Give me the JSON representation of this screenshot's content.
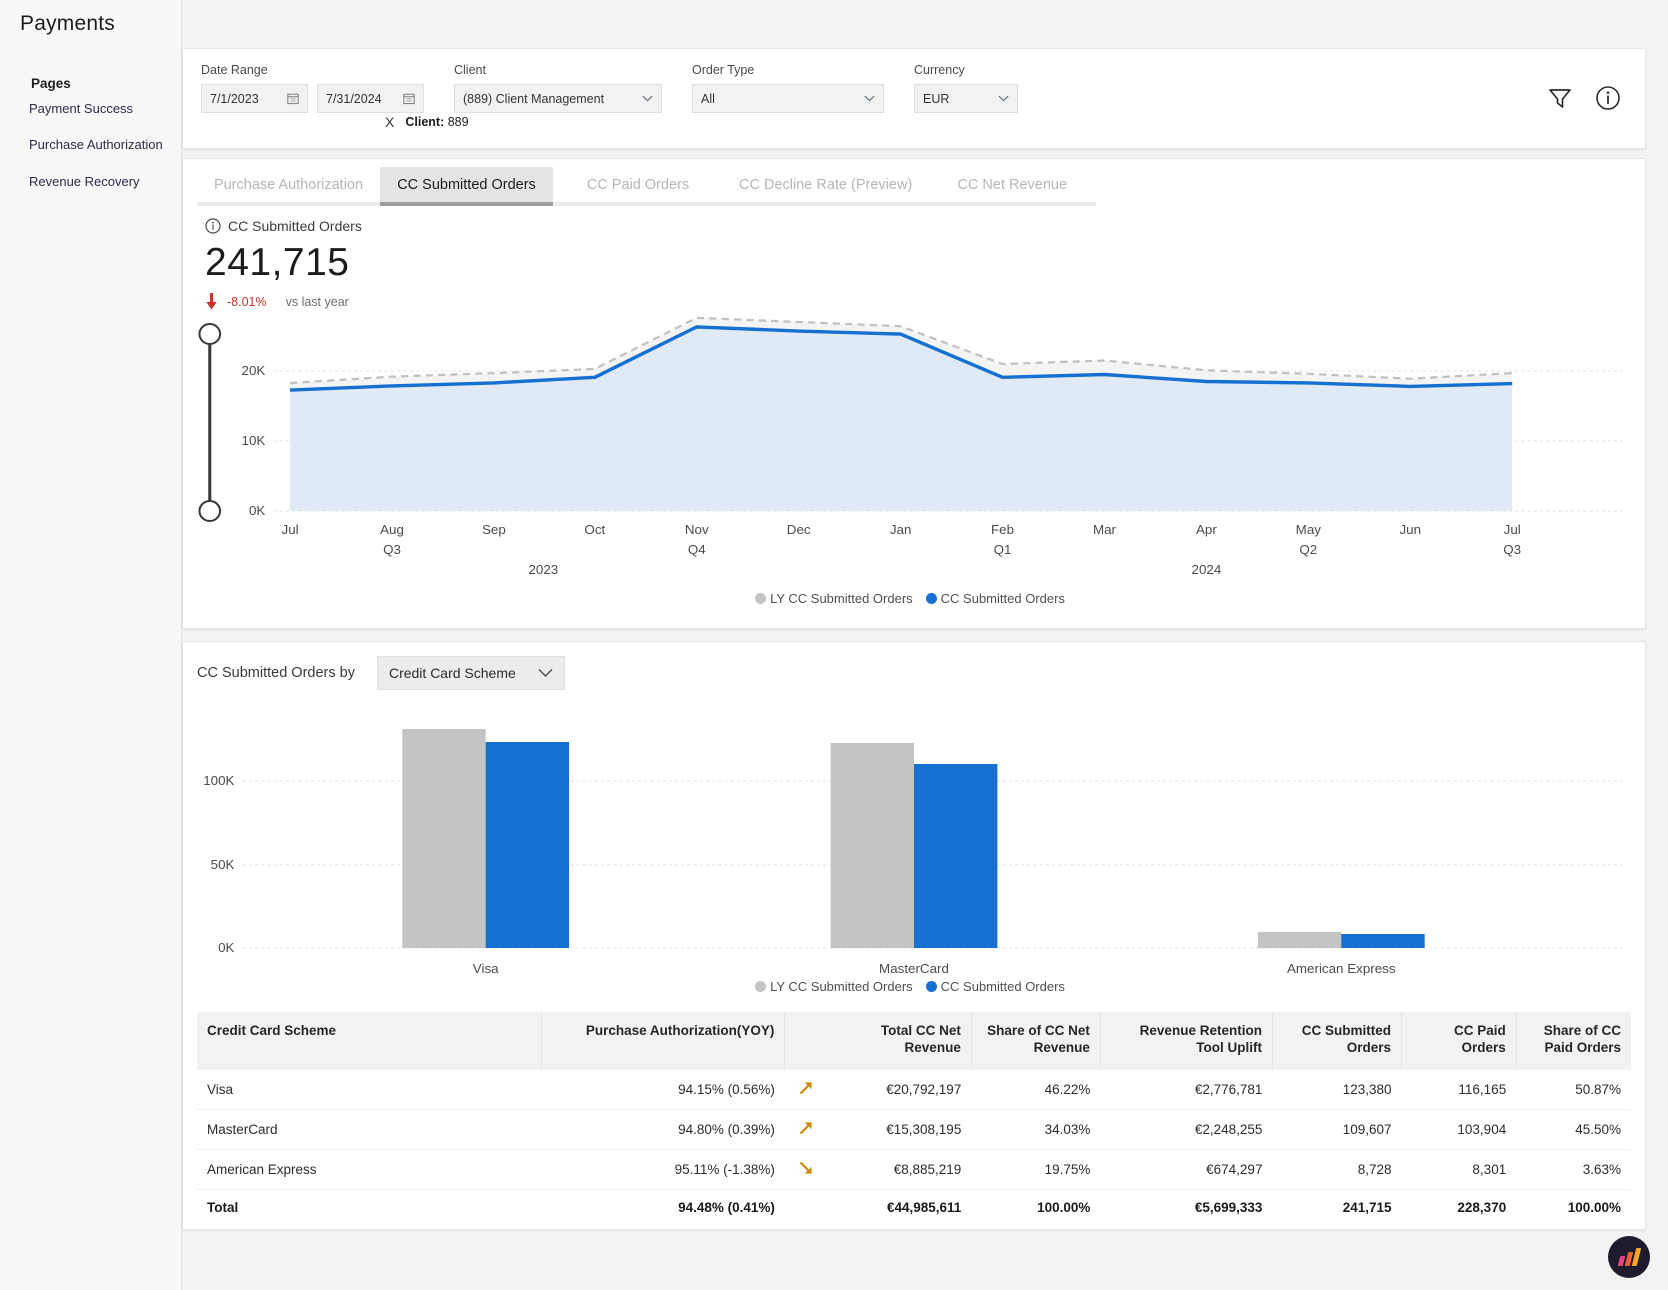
{
  "app": {
    "title": "Payments"
  },
  "sidebar": {
    "header": "Pages",
    "items": [
      {
        "label": "Payment Success"
      },
      {
        "label": "Purchase Authorization"
      },
      {
        "label": "Revenue Recovery"
      }
    ]
  },
  "filters": {
    "date_range": {
      "label": "Date Range",
      "start": "7/1/2023",
      "end": "7/31/2024"
    },
    "client": {
      "label": "Client",
      "value": "(889) Client Management"
    },
    "order_type": {
      "label": "Order Type",
      "value": "All"
    },
    "currency": {
      "label": "Currency",
      "value": "EUR"
    },
    "chip": {
      "close": "X",
      "key": "Client:",
      "value": "889"
    }
  },
  "tabs": [
    {
      "label": "Purchase Authorization",
      "active": false
    },
    {
      "label": "CC Submitted Orders",
      "active": true
    },
    {
      "label": "CC Paid Orders",
      "active": false
    },
    {
      "label": "CC Decline Rate (Preview)",
      "active": false
    },
    {
      "label": "CC Net Revenue",
      "active": false
    }
  ],
  "kpi": {
    "title": "CC Submitted Orders",
    "value": "241,715",
    "delta": "-8.01%",
    "delta_direction": "down",
    "delta_color": "#c0392b",
    "comparison": "vs last year"
  },
  "colors": {
    "current": "#1570d1",
    "current_fill": "#dfeaf6",
    "last_year": "#c4c4c4",
    "trend_up": "#d1860b",
    "trend_down": "#d1860b"
  },
  "bar_section": {
    "label": "CC Submitted Orders by",
    "dimension": "Credit Card Scheme"
  },
  "chart_data": [
    {
      "type": "area",
      "title": "CC Submitted Orders",
      "xlabel": "",
      "ylabel": "",
      "ylim": [
        0,
        30000
      ],
      "yticks": [
        0,
        10000,
        20000
      ],
      "ytick_labels": [
        "0K",
        "10K",
        "20K"
      ],
      "grid": true,
      "legend_position": "bottom",
      "x": [
        "Jul",
        "Aug",
        "Sep",
        "Oct",
        "Nov",
        "Dec",
        "Jan",
        "Feb",
        "Mar",
        "Apr",
        "May",
        "Jun",
        "Jul"
      ],
      "x_quarters": [
        {
          "label": "Q3",
          "at": "Aug"
        },
        {
          "label": "Q4",
          "at": "Nov"
        },
        {
          "label": "Q1",
          "at": "Feb"
        },
        {
          "label": "Q2",
          "at": "May"
        },
        {
          "label": "Q3",
          "at": "Jul"
        }
      ],
      "x_years": [
        {
          "label": "2023",
          "at": "Sep"
        },
        {
          "label": "2024",
          "at": "Apr"
        }
      ],
      "series": [
        {
          "name": "LY CC Submitted Orders",
          "color": "#c4c4c4",
          "style": "dashed",
          "values": [
            18300,
            19200,
            19700,
            20300,
            27600,
            27000,
            26400,
            21000,
            21500,
            20100,
            19600,
            18900,
            19700
          ]
        },
        {
          "name": "CC Submitted Orders",
          "color": "#1570d1",
          "style": "solid",
          "values": [
            17300,
            17900,
            18300,
            19100,
            26300,
            25700,
            25300,
            19100,
            19500,
            18500,
            18300,
            17800,
            18200
          ]
        }
      ]
    },
    {
      "type": "bar",
      "title": "CC Submitted Orders by Credit Card Scheme",
      "xlabel": "",
      "ylabel": "",
      "ylim": [
        0,
        150000
      ],
      "yticks": [
        0,
        50000,
        100000
      ],
      "ytick_labels": [
        "0K",
        "50K",
        "100K"
      ],
      "grid": true,
      "legend_position": "bottom",
      "categories": [
        "Visa",
        "MasterCard",
        "American Express"
      ],
      "series": [
        {
          "name": "LY CC Submitted Orders",
          "color": "#c4c4c4",
          "values": [
            131000,
            123000,
            9600
          ]
        },
        {
          "name": "CC Submitted Orders",
          "color": "#1570d1",
          "values": [
            123380,
            109607,
            8728
          ]
        }
      ]
    }
  ],
  "table": {
    "columns": [
      {
        "label": "Credit Card Scheme",
        "align": "l"
      },
      {
        "label": "Purchase Authorization(YOY)",
        "align": "r"
      },
      {
        "label": "",
        "align": "r"
      },
      {
        "label": "Total CC Net Revenue",
        "align": "r"
      },
      {
        "label": "Share of CC Net Revenue",
        "align": "r"
      },
      {
        "label": "Revenue Retention Tool Uplift",
        "align": "r"
      },
      {
        "label": "CC Submitted Orders",
        "align": "r"
      },
      {
        "label": "CC Paid Orders",
        "align": "r"
      },
      {
        "label": "Share of CC Paid Orders",
        "align": "r"
      }
    ],
    "rows": [
      {
        "scheme": "Visa",
        "purchase_auth": "94.15% (0.56%)",
        "trend": "up",
        "net_revenue": "€20,792,197",
        "share_net_revenue": "46.22%",
        "retention_uplift": "€2,776,781",
        "submitted_orders": "123,380",
        "paid_orders": "116,165",
        "share_paid_orders": "50.87%"
      },
      {
        "scheme": "MasterCard",
        "purchase_auth": "94.80% (0.39%)",
        "trend": "up",
        "net_revenue": "€15,308,195",
        "share_net_revenue": "34.03%",
        "retention_uplift": "€2,248,255",
        "submitted_orders": "109,607",
        "paid_orders": "103,904",
        "share_paid_orders": "45.50%"
      },
      {
        "scheme": "American Express",
        "purchase_auth": "95.11% (-1.38%)",
        "trend": "down",
        "net_revenue": "€8,885,219",
        "share_net_revenue": "19.75%",
        "retention_uplift": "€674,297",
        "submitted_orders": "8,728",
        "paid_orders": "8,301",
        "share_paid_orders": "3.63%"
      }
    ],
    "total": {
      "scheme": "Total",
      "purchase_auth": "94.48% (0.41%)",
      "trend": "",
      "net_revenue": "€44,985,611",
      "share_net_revenue": "100.00%",
      "retention_uplift": "€5,699,333",
      "submitted_orders": "241,715",
      "paid_orders": "228,370",
      "share_paid_orders": "100.00%"
    }
  }
}
